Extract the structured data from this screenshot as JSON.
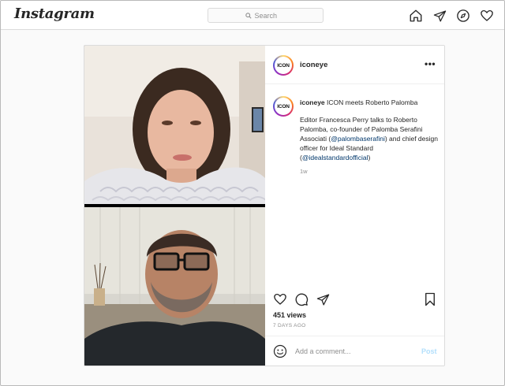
{
  "header": {
    "logo": "Instagram",
    "search_placeholder": "Search",
    "nav_icons": [
      "home-icon",
      "direct-icon",
      "explore-icon",
      "activity-icon"
    ]
  },
  "post": {
    "author": {
      "username": "iconeye",
      "avatar_text": "ICON"
    },
    "caption": {
      "username": "iconeye",
      "title": "ICON meets Roberto Palomba",
      "text_before": "Editor Francesca Perry talks to Roberto Palomba, co-founder of Palomba Serafini Associati (",
      "mention_1": "@palombaserafini",
      "text_middle": ") and chief design officer for Ideal Standard (",
      "mention_2": "@idealstandardofficial",
      "text_after": ")",
      "age": "1w"
    },
    "more_label": "•••",
    "views": "451 views",
    "date": "7 DAYS AGO",
    "comment_placeholder": "Add a comment...",
    "post_label": "Post"
  },
  "colors": {
    "link": "#00376b",
    "post_button_disabled": "#b2dffc",
    "border": "#dbdbdb",
    "muted_text": "#8e8e8e"
  }
}
